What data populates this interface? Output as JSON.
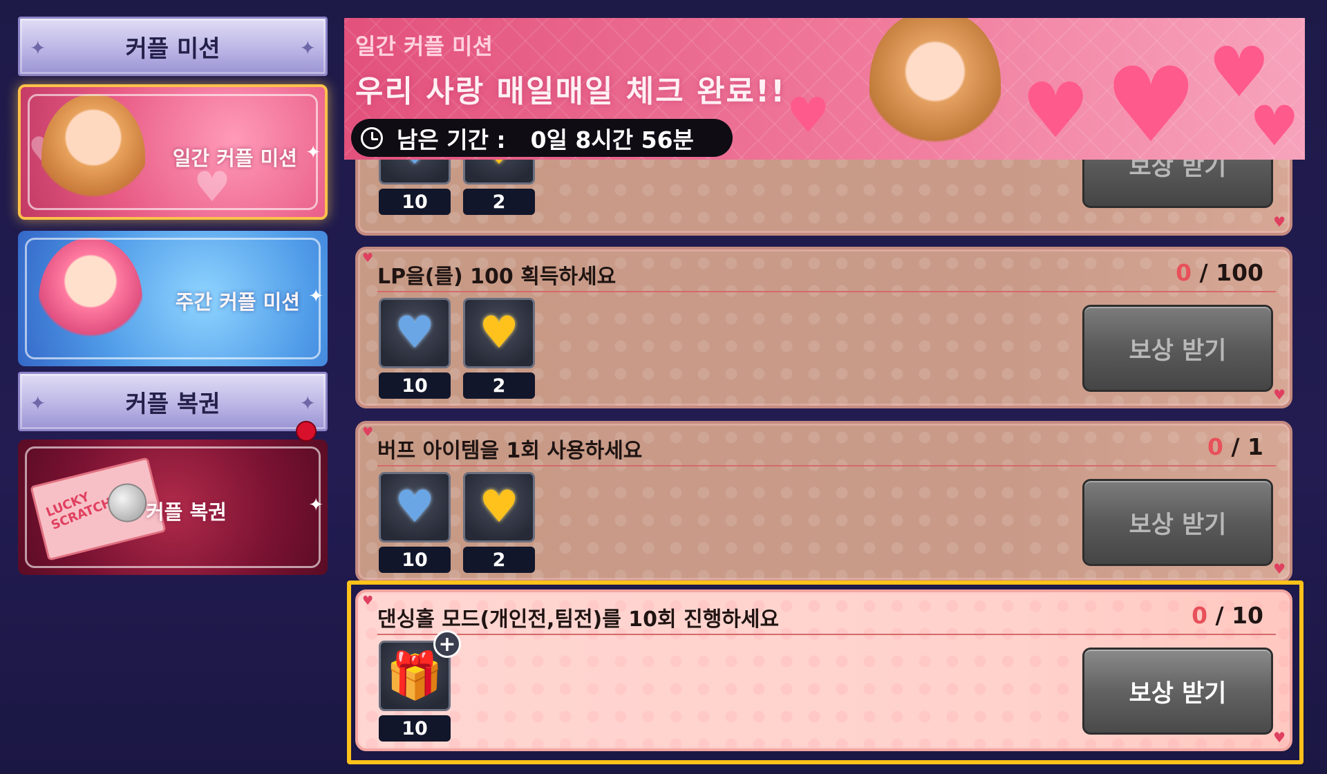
{
  "sidebar": {
    "header_missions": "커플 미션",
    "daily_card_label": "일간 커플 미션",
    "weekly_card_label": "주간 커플 미션",
    "header_lottery": "커플 복권",
    "lottery_card_label": "커플 복권",
    "ticket_text": "LUCKY SCRATCH"
  },
  "banner": {
    "subtitle": "일간 커플 미션",
    "title": "우리 사랑 매일매일 체크 완료!!",
    "timer_label": "남은 기간 :",
    "timer_value": "0일 8시간 56분"
  },
  "missions": [
    {
      "title": "",
      "rewards": [
        {
          "icon": "blue-heart-icon",
          "count": "10"
        },
        {
          "icon": "gold-heart-icon",
          "count": "2"
        }
      ],
      "claim_label": "보상 받기"
    },
    {
      "title": "LP을(를) 100 획득하세요",
      "progress_current": "0",
      "progress_sep": " / ",
      "progress_total": "100",
      "rewards": [
        {
          "icon": "blue-heart-icon",
          "count": "10"
        },
        {
          "icon": "gold-heart-icon",
          "count": "2"
        }
      ],
      "claim_label": "보상 받기"
    },
    {
      "title": "버프 아이템을 1회 사용하세요",
      "progress_current": "0",
      "progress_sep": " / ",
      "progress_total": "1",
      "rewards": [
        {
          "icon": "blue-heart-icon",
          "count": "10"
        },
        {
          "icon": "gold-heart-icon",
          "count": "2"
        }
      ],
      "claim_label": "보상 받기"
    },
    {
      "title": "댄싱홀  모드(개인전,팀전)를 10회 진행하세요",
      "progress_current": "0",
      "progress_sep": " / ",
      "progress_total": "10",
      "rewards": [
        {
          "icon": "gift-box-icon",
          "count": "10"
        }
      ],
      "claim_label": "보상 받기"
    }
  ],
  "colors": {
    "accent_highlight": "#ffc21a",
    "progress_current": "#e8505a",
    "background": "#1e1a48"
  }
}
